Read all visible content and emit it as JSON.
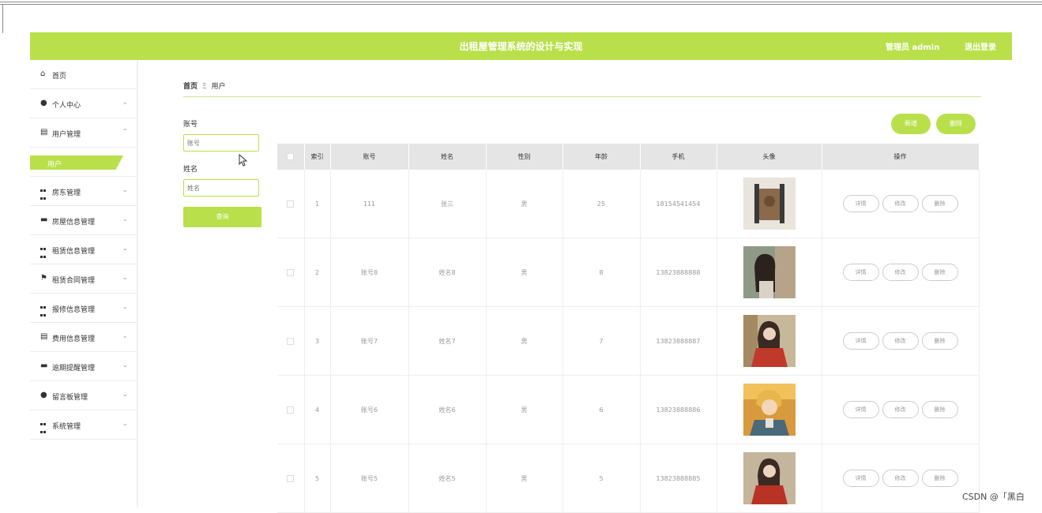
{
  "header": {
    "title": "出租屋管理系统的设计与实现",
    "admin": "管理员 admin",
    "logout": "退出登录"
  },
  "sidebar": {
    "items": [
      {
        "label": "首页"
      },
      {
        "label": "个人中心"
      },
      {
        "label": "用户管理"
      },
      {
        "label": "用户"
      },
      {
        "label": "房东管理"
      },
      {
        "label": "房屋信息管理"
      },
      {
        "label": "租赁信息管理"
      },
      {
        "label": "租赁合同管理"
      },
      {
        "label": "报修信息管理"
      },
      {
        "label": "费用信息管理"
      },
      {
        "label": "逾期提醒管理"
      },
      {
        "label": "留言板管理"
      },
      {
        "label": "系统管理"
      }
    ]
  },
  "breadcrumb": {
    "home": "首页",
    "sep": "Ξ",
    "current": "用户"
  },
  "search": {
    "account_label": "账号",
    "account_placeholder": "账号",
    "name_label": "姓名",
    "name_placeholder": "姓名",
    "query": "查询"
  },
  "actions": {
    "add": "新增",
    "delete": "删除"
  },
  "table": {
    "headers": [
      "索引",
      "账号",
      "姓名",
      "性别",
      "年龄",
      "手机",
      "头像",
      "操作"
    ],
    "rows": [
      {
        "index": "1",
        "account": "111",
        "name": "张三",
        "gender": "男",
        "age": "25",
        "phone": "18154541454"
      },
      {
        "index": "2",
        "account": "账号8",
        "name": "姓名8",
        "gender": "男",
        "age": "8",
        "phone": "13823888888"
      },
      {
        "index": "3",
        "account": "账号7",
        "name": "姓名7",
        "gender": "男",
        "age": "7",
        "phone": "13823888887"
      },
      {
        "index": "4",
        "account": "账号6",
        "name": "姓名6",
        "gender": "男",
        "age": "6",
        "phone": "13823888886"
      },
      {
        "index": "5",
        "account": "账号5",
        "name": "姓名5",
        "gender": "男",
        "age": "5",
        "phone": "13823888885"
      }
    ],
    "ops": {
      "detail": "详情",
      "edit": "修改",
      "delete": "删除"
    }
  },
  "watermark": "CSDN @「黑白"
}
